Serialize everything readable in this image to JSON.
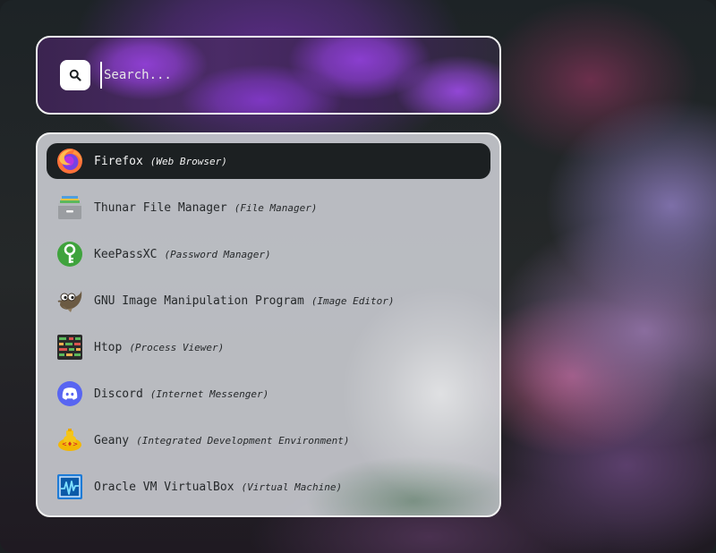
{
  "search": {
    "placeholder": "Search...",
    "value": ""
  },
  "results": [
    {
      "name": "Firefox",
      "category": "(Web Browser)",
      "icon": "firefox-icon",
      "selected": true
    },
    {
      "name": "Thunar File Manager",
      "category": "(File Manager)",
      "icon": "file-manager-icon",
      "selected": false
    },
    {
      "name": "KeePassXC",
      "category": "(Password Manager)",
      "icon": "keepassxc-icon",
      "selected": false
    },
    {
      "name": "GNU Image Manipulation Program",
      "category": "(Image Editor)",
      "icon": "gimp-icon",
      "selected": false
    },
    {
      "name": "Htop",
      "category": "(Process Viewer)",
      "icon": "htop-icon",
      "selected": false
    },
    {
      "name": "Discord",
      "category": "(Internet Messenger)",
      "icon": "discord-icon",
      "selected": false
    },
    {
      "name": "Geany",
      "category": "(Integrated Development Environment)",
      "icon": "geany-icon",
      "selected": false
    },
    {
      "name": "Oracle VM VirtualBox",
      "category": "(Virtual Machine)",
      "icon": "virtualbox-icon",
      "selected": false
    }
  ],
  "colors": {
    "selected_row": "#1c2022",
    "panel_border": "#f2f2f2",
    "text_dark": "#26292b",
    "text_light": "#f2f2f2"
  }
}
